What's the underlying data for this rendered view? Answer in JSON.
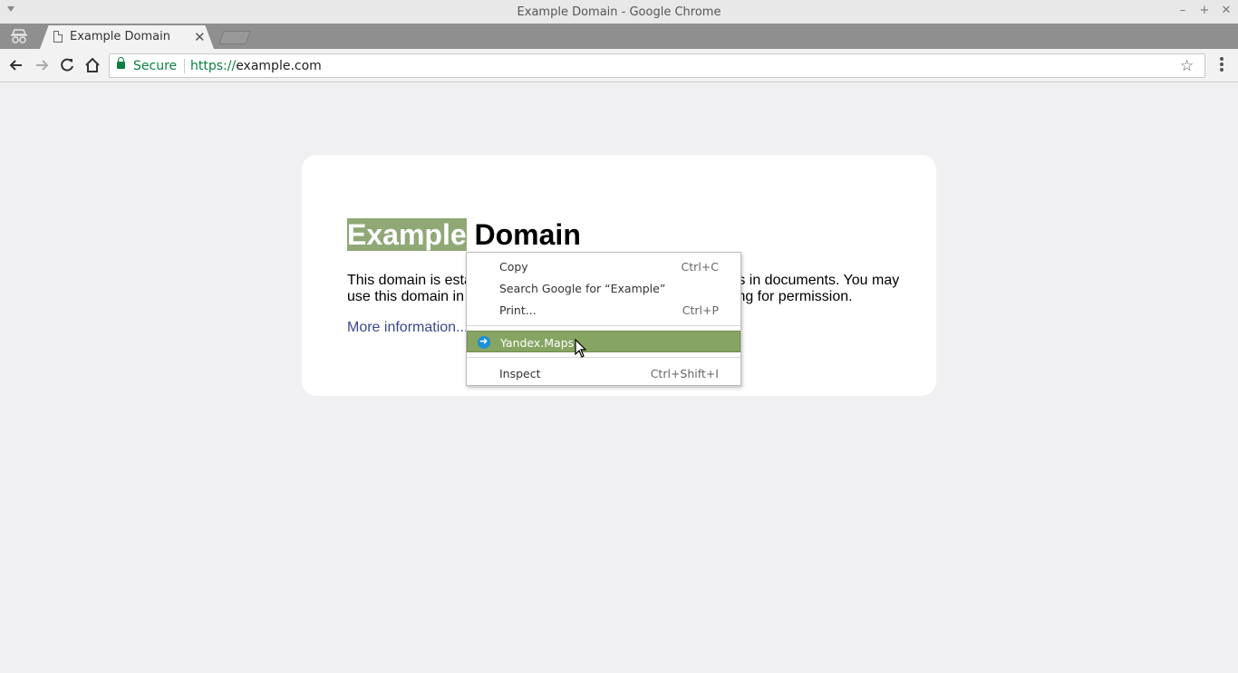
{
  "window": {
    "title": "Example Domain - Google Chrome"
  },
  "tab": {
    "title": "Example Domain"
  },
  "omnibox": {
    "security_label": "Secure",
    "url_scheme": "https://",
    "url_host": "example.com"
  },
  "page": {
    "heading_selected": "Example",
    "heading_rest": " Domain",
    "paragraph": "This domain is established to be used for illustrative examples in documents. You may use this domain in literature without prior coordination or asking for permission.",
    "link": "More information..."
  },
  "context_menu": {
    "items": [
      {
        "label": "Copy",
        "shortcut": "Ctrl+C"
      },
      {
        "label": "Search Google for “Example”",
        "shortcut": ""
      },
      {
        "label": "Print...",
        "shortcut": "Ctrl+P"
      },
      {
        "label": "Yandex.Maps",
        "shortcut": "",
        "icon": "arrow-right-circle-icon",
        "highlighted": true
      },
      {
        "label": "Inspect",
        "shortcut": "Ctrl+Shift+I"
      }
    ]
  },
  "colors": {
    "selection": "#8fa876",
    "menu_highlight": "#86a462",
    "secure_green": "#0b8043",
    "link": "#38488f"
  }
}
